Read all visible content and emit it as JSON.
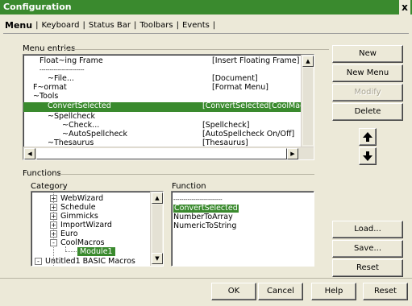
{
  "window": {
    "title": "Configuration",
    "close_label": "x"
  },
  "tabs": [
    {
      "label": "Menu",
      "active": true
    },
    {
      "label": "Keyboard"
    },
    {
      "label": "Status Bar"
    },
    {
      "label": "Toolbars"
    },
    {
      "label": "Events"
    }
  ],
  "tab_separator": "|",
  "menu_entries": {
    "label": "Menu entries",
    "rows": [
      {
        "name": "Float~ing Frame",
        "command": "[Insert Floating Frame]",
        "indent": 1
      },
      {
        "name": "----------------------",
        "command": "",
        "indent": 1
      },
      {
        "name": "~File...",
        "command": "[Document]",
        "indent": 1
      },
      {
        "name": "F~ormat",
        "command": "[Format Menu]",
        "indent": 0
      },
      {
        "name": "~Tools",
        "command": "",
        "indent": 0
      },
      {
        "name": "ConvertSelected",
        "command": "[ConvertSelected[CoolMacros",
        "indent": 1,
        "selected": true
      },
      {
        "name": "~Spellcheck",
        "command": "",
        "indent": 1
      },
      {
        "name": "~Check...",
        "command": "[Spellcheck]",
        "indent": 2
      },
      {
        "name": "~AutoSpellcheck",
        "command": "[AutoSpellcheck On/Off]",
        "indent": 2
      },
      {
        "name": "~Thesaurus",
        "command": "[Thesaurus]",
        "indent": 1
      }
    ]
  },
  "side_buttons": {
    "new": "New",
    "new_menu": "New Menu",
    "modify": "Modify",
    "delete": "Delete"
  },
  "functions": {
    "label": "Functions",
    "category_label": "Category",
    "function_label": "Function",
    "categories": [
      {
        "label": "WebWizard",
        "toggle": "+"
      },
      {
        "label": "Schedule",
        "toggle": "+"
      },
      {
        "label": "Gimmicks",
        "toggle": "+"
      },
      {
        "label": "ImportWizard",
        "toggle": "+"
      },
      {
        "label": "Euro",
        "toggle": "+"
      },
      {
        "label": "CoolMacros",
        "toggle": "-"
      },
      {
        "label": "Module1",
        "toggle": "",
        "selected": true
      },
      {
        "label": "Untitled1 BASIC Macros",
        "toggle": "-"
      }
    ],
    "function_items": [
      {
        "label": "------------------------"
      },
      {
        "label": "ConvertSelected",
        "selected": true
      },
      {
        "label": "NumberToArray"
      },
      {
        "label": "NumericToString"
      }
    ]
  },
  "file_buttons": {
    "load": "Load...",
    "save": "Save...",
    "reset": "Reset"
  },
  "footer_buttons": {
    "ok": "OK",
    "cancel": "Cancel",
    "help": "Help",
    "reset": "Reset"
  },
  "colors": {
    "accent": "#3a8a2e",
    "dialog_bg": "#ece9d8"
  },
  "icons": {
    "move_up": "arrow-up-icon",
    "move_down": "arrow-down-icon"
  }
}
